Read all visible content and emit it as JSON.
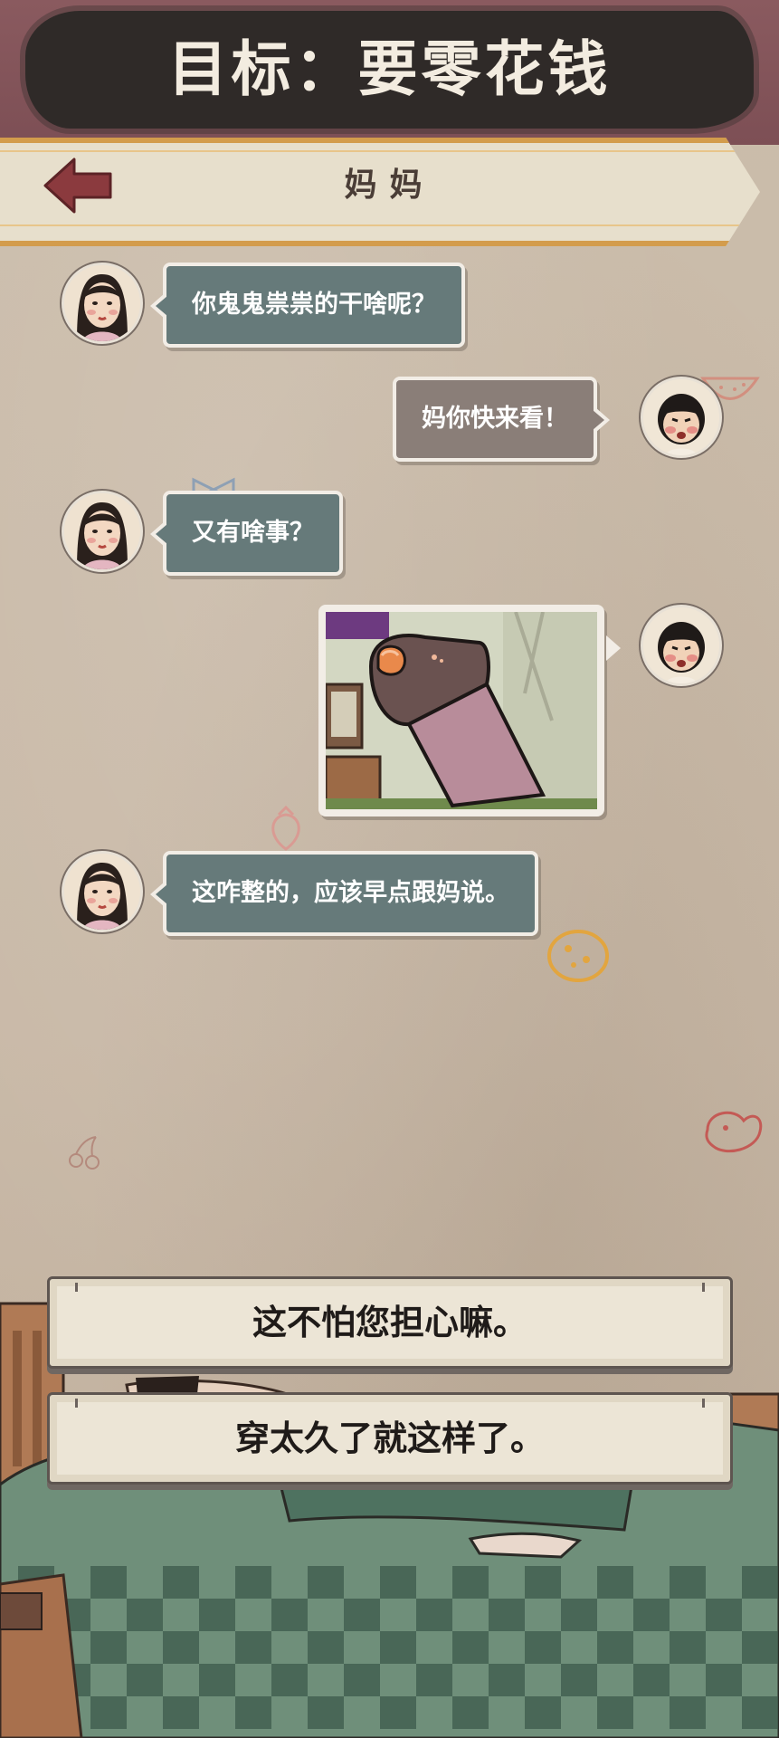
{
  "objective": {
    "title": "目标：要零花钱"
  },
  "header": {
    "contact_name": "妈妈"
  },
  "messages": [
    {
      "sender": "mom",
      "text": "你鬼鬼祟祟的干啥呢？"
    },
    {
      "sender": "me",
      "text": "妈你快来看！"
    },
    {
      "sender": "mom",
      "text": "又有啥事？"
    },
    {
      "sender": "me",
      "type": "image"
    },
    {
      "sender": "mom",
      "text": "这咋整的，应该早点跟妈说。"
    }
  ],
  "choices": [
    {
      "label": "这不怕您担心嘛。"
    },
    {
      "label": "穿太久了就这样了。"
    }
  ],
  "colors": {
    "mom_bubble": "#667a7a",
    "me_bubble": "#8a7e78",
    "accent_border": "#d39c4c",
    "back_arrow": "#8b3a3e"
  },
  "icons": [
    "back-arrow-icon",
    "mom-avatar",
    "child-avatar",
    "socks-photo"
  ]
}
